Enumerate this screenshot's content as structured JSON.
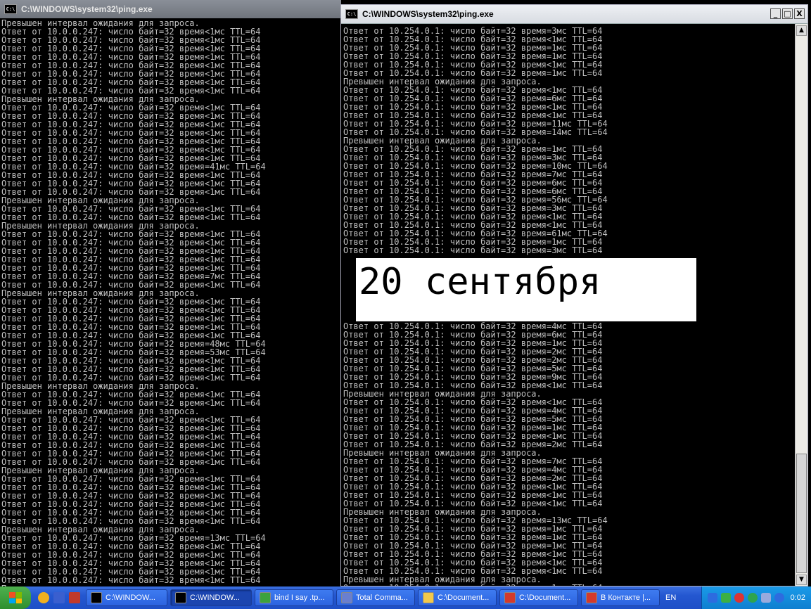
{
  "left_window": {
    "title": "C:\\WINDOWS\\system32\\ping.exe",
    "lines": [
      "Превышен интервал ожидания для запроса.",
      "Ответ от 10.0.0.247: число байт=32 время<1мс TTL=64",
      "Ответ от 10.0.0.247: число байт=32 время<1мс TTL=64",
      "Ответ от 10.0.0.247: число байт=32 время<1мс TTL=64",
      "Ответ от 10.0.0.247: число байт=32 время<1мс TTL=64",
      "Ответ от 10.0.0.247: число байт=32 время<1мс TTL=64",
      "Ответ от 10.0.0.247: число байт=32 время<1мс TTL=64",
      "Ответ от 10.0.0.247: число байт=32 время<1мс TTL=64",
      "Ответ от 10.0.0.247: число байт=32 время<1мс TTL=64",
      "Превышен интервал ожидания для запроса.",
      "Ответ от 10.0.0.247: число байт=32 время<1мс TTL=64",
      "Ответ от 10.0.0.247: число байт=32 время<1мс TTL=64",
      "Ответ от 10.0.0.247: число байт=32 время<1мс TTL=64",
      "Ответ от 10.0.0.247: число байт=32 время<1мс TTL=64",
      "Ответ от 10.0.0.247: число байт=32 время<1мс TTL=64",
      "Ответ от 10.0.0.247: число байт=32 время<1мс TTL=64",
      "Ответ от 10.0.0.247: число байт=32 время<1мс TTL=64",
      "Ответ от 10.0.0.247: число байт=32 время=41мс TTL=64",
      "Ответ от 10.0.0.247: число байт=32 время<1мс TTL=64",
      "Ответ от 10.0.0.247: число байт=32 время<1мс TTL=64",
      "Ответ от 10.0.0.247: число байт=32 время<1мс TTL=64",
      "Превышен интервал ожидания для запроса.",
      "Ответ от 10.0.0.247: число байт=32 время<1мс TTL=64",
      "Ответ от 10.0.0.247: число байт=32 время<1мс TTL=64",
      "Превышен интервал ожидания для запроса.",
      "Ответ от 10.0.0.247: число байт=32 время<1мс TTL=64",
      "Ответ от 10.0.0.247: число байт=32 время<1мс TTL=64",
      "Ответ от 10.0.0.247: число байт=32 время<1мс TTL=64",
      "Ответ от 10.0.0.247: число байт=32 время<1мс TTL=64",
      "Ответ от 10.0.0.247: число байт=32 время<1мс TTL=64",
      "Ответ от 10.0.0.247: число байт=32 время=7мс TTL=64",
      "Ответ от 10.0.0.247: число байт=32 время<1мс TTL=64",
      "Превышен интервал ожидания для запроса.",
      "Ответ от 10.0.0.247: число байт=32 время<1мс TTL=64",
      "Ответ от 10.0.0.247: число байт=32 время<1мс TTL=64",
      "Ответ от 10.0.0.247: число байт=32 время<1мс TTL=64",
      "Ответ от 10.0.0.247: число байт=32 время<1мс TTL=64",
      "Ответ от 10.0.0.247: число байт=32 время<1мс TTL=64",
      "Ответ от 10.0.0.247: число байт=32 время=48мс TTL=64",
      "Ответ от 10.0.0.247: число байт=32 время=53мс TTL=64",
      "Ответ от 10.0.0.247: число байт=32 время<1мс TTL=64",
      "Ответ от 10.0.0.247: число байт=32 время<1мс TTL=64",
      "Ответ от 10.0.0.247: число байт=32 время<1мс TTL=64",
      "Превышен интервал ожидания для запроса.",
      "Ответ от 10.0.0.247: число байт=32 время<1мс TTL=64",
      "Ответ от 10.0.0.247: число байт=32 время<1мс TTL=64",
      "Превышен интервал ожидания для запроса.",
      "Ответ от 10.0.0.247: число байт=32 время<1мс TTL=64",
      "Ответ от 10.0.0.247: число байт=32 время<1мс TTL=64",
      "Ответ от 10.0.0.247: число байт=32 время<1мс TTL=64",
      "Ответ от 10.0.0.247: число байт=32 время<1мс TTL=64",
      "Ответ от 10.0.0.247: число байт=32 время<1мс TTL=64",
      "Ответ от 10.0.0.247: число байт=32 время<1мс TTL=64",
      "Превышен интервал ожидания для запроса.",
      "Ответ от 10.0.0.247: число байт=32 время<1мс TTL=64",
      "Ответ от 10.0.0.247: число байт=32 время<1мс TTL=64",
      "Ответ от 10.0.0.247: число байт=32 время<1мс TTL=64",
      "Ответ от 10.0.0.247: число байт=32 время<1мс TTL=64",
      "Ответ от 10.0.0.247: число байт=32 время<1мс TTL=64",
      "Ответ от 10.0.0.247: число байт=32 время<1мс TTL=64",
      "Превышен интервал ожидания для запроса.",
      "Ответ от 10.0.0.247: число байт=32 время=13мс TTL=64",
      "Ответ от 10.0.0.247: число байт=32 время<1мс TTL=64",
      "Ответ от 10.0.0.247: число байт=32 время<1мс TTL=64",
      "Ответ от 10.0.0.247: число байт=32 время<1мс TTL=64",
      "Ответ от 10.0.0.247: число байт=32 время<1мс TTL=64",
      "Ответ от 10.0.0.247: число байт=32 время<1мс TTL=64",
      "Превышен интервал ожидания для запроса.",
      "Ответ от 10.0.0.247: число байт=32 время<1мс TTL=64"
    ]
  },
  "right_window": {
    "title": "C:\\WINDOWS\\system32\\ping.exe",
    "lines": [
      "Ответ от 10.254.0.1: число байт=32 время=3мс TTL=64",
      "Ответ от 10.254.0.1: число байт=32 время<1мс TTL=64",
      "Ответ от 10.254.0.1: число байт=32 время=1мс TTL=64",
      "Ответ от 10.254.0.1: число байт=32 время=1мс TTL=64",
      "Ответ от 10.254.0.1: число байт=32 время<1мс TTL=64",
      "Ответ от 10.254.0.1: число байт=32 время=1мс TTL=64",
      "Превышен интервал ожидания для запроса.",
      "Ответ от 10.254.0.1: число байт=32 время<1мс TTL=64",
      "Ответ от 10.254.0.1: число байт=32 время=6мс TTL=64",
      "Ответ от 10.254.0.1: число байт=32 время<1мс TTL=64",
      "Ответ от 10.254.0.1: число байт=32 время<1мс TTL=64",
      "Ответ от 10.254.0.1: число байт=32 время=11мс TTL=64",
      "Ответ от 10.254.0.1: число байт=32 время=14мс TTL=64",
      "Превышен интервал ожидания для запроса.",
      "Ответ от 10.254.0.1: число байт=32 время=1мс TTL=64",
      "Ответ от 10.254.0.1: число байт=32 время=3мс TTL=64",
      "Ответ от 10.254.0.1: число байт=32 время=10мс TTL=64",
      "Ответ от 10.254.0.1: число байт=32 время=7мс TTL=64",
      "Ответ от 10.254.0.1: число байт=32 время=6мс TTL=64",
      "Ответ от 10.254.0.1: число байт=32 время=6мс TTL=64",
      "Ответ от 10.254.0.1: число байт=32 время=56мс TTL=64",
      "Ответ от 10.254.0.1: число байт=32 время=3мс TTL=64",
      "Ответ от 10.254.0.1: число байт=32 время<1мс TTL=64",
      "Ответ от 10.254.0.1: число байт=32 время<1мс TTL=64",
      "Ответ от 10.254.0.1: число байт=32 время=61мс TTL=64",
      "Ответ от 10.254.0.1: число байт=32 время=1мс TTL=64",
      "Ответ от 10.254.0.1: число байт=32 время=3мс TTL=64",
      "",
      "",
      "",
      "",
      "",
      "",
      "",
      "",
      "Ответ от 10.254.0.1: число байт=32 время=4мс TTL=64",
      "Ответ от 10.254.0.1: число байт=32 время=6мс TTL=64",
      "Ответ от 10.254.0.1: число байт=32 время=1мс TTL=64",
      "Ответ от 10.254.0.1: число байт=32 время=2мс TTL=64",
      "Ответ от 10.254.0.1: число байт=32 время=2мс TTL=64",
      "Ответ от 10.254.0.1: число байт=32 время=5мс TTL=64",
      "Ответ от 10.254.0.1: число байт=32 время=9мс TTL=64",
      "Ответ от 10.254.0.1: число байт=32 время<1мс TTL=64",
      "Превышен интервал ожидания для запроса.",
      "Ответ от 10.254.0.1: число байт=32 время<1мс TTL=64",
      "Ответ от 10.254.0.1: число байт=32 время=4мс TTL=64",
      "Ответ от 10.254.0.1: число байт=32 время=5мс TTL=64",
      "Ответ от 10.254.0.1: число байт=32 время=1мс TTL=64",
      "Ответ от 10.254.0.1: число байт=32 время<1мс TTL=64",
      "Ответ от 10.254.0.1: число байт=32 время=2мс TTL=64",
      "Превышен интервал ожидания для запроса.",
      "Ответ от 10.254.0.1: число байт=32 время=7мс TTL=64",
      "Ответ от 10.254.0.1: число байт=32 время=4мс TTL=64",
      "Ответ от 10.254.0.1: число байт=32 время=2мс TTL=64",
      "Ответ от 10.254.0.1: число байт=32 время<1мс TTL=64",
      "Ответ от 10.254.0.1: число байт=32 время<1мс TTL=64",
      "Ответ от 10.254.0.1: число байт=32 время<1мс TTL=64",
      "Превышен интервал ожидания для запроса.",
      "Ответ от 10.254.0.1: число байт=32 время=13мс TTL=64",
      "Ответ от 10.254.0.1: число байт=32 время=1мс TTL=64",
      "Ответ от 10.254.0.1: число байт=32 время=1мс TTL=64",
      "Ответ от 10.254.0.1: число байт=32 время=1мс TTL=64",
      "Ответ от 10.254.0.1: число байт=32 время<1мс TTL=64",
      "Ответ от 10.254.0.1: число байт=32 время<1мс TTL=64",
      "Ответ от 10.254.0.1: число байт=32 время<1мс TTL=64",
      "Превышен интервал ожидания для запроса.",
      "Ответ от 10.254.0.1: число байт=32 время<1мс TTL=64"
    ],
    "window_buttons": {
      "minimize": "_",
      "maximize": "□",
      "close": "X"
    }
  },
  "overlay": {
    "date_text": "20 сентября"
  },
  "taskbar": {
    "tasks": [
      {
        "label": "C:\\WINDOW...",
        "icon": "cmd-icon",
        "color": "#000000"
      },
      {
        "label": "C:\\WINDOW...",
        "icon": "cmd-icon",
        "color": "#000000"
      },
      {
        "label": "bind I say .tp...",
        "icon": "notepad-icon",
        "color": "#3ca23c"
      },
      {
        "label": "Total Comma...",
        "icon": "total-commander-icon",
        "color": "#6a7fcf"
      },
      {
        "label": "C:\\Document...",
        "icon": "folder-icon",
        "color": "#f2c94c"
      },
      {
        "label": "C:\\Document...",
        "icon": "opera-icon",
        "color": "#d33a2c"
      },
      {
        "label": "В Контакте |...",
        "icon": "opera-icon",
        "color": "#d33a2c"
      }
    ],
    "language": "EN",
    "clock": "0:02"
  }
}
